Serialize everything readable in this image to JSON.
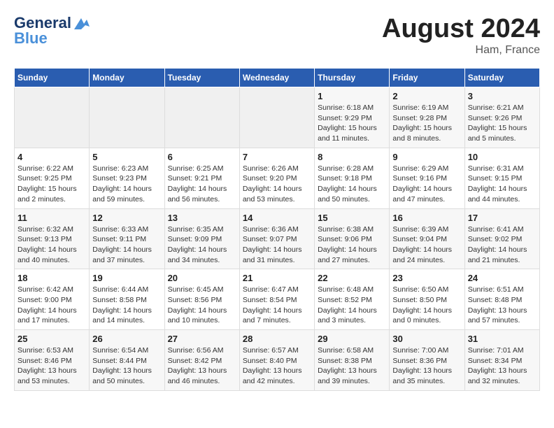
{
  "header": {
    "logo_line1": "General",
    "logo_line2": "Blue",
    "main_title": "August 2024",
    "subtitle": "Ham, France"
  },
  "calendar": {
    "days_of_week": [
      "Sunday",
      "Monday",
      "Tuesday",
      "Wednesday",
      "Thursday",
      "Friday",
      "Saturday"
    ],
    "weeks": [
      [
        {
          "day": "",
          "info": ""
        },
        {
          "day": "",
          "info": ""
        },
        {
          "day": "",
          "info": ""
        },
        {
          "day": "",
          "info": ""
        },
        {
          "day": "1",
          "info": "Sunrise: 6:18 AM\nSunset: 9:29 PM\nDaylight: 15 hours\nand 11 minutes."
        },
        {
          "day": "2",
          "info": "Sunrise: 6:19 AM\nSunset: 9:28 PM\nDaylight: 15 hours\nand 8 minutes."
        },
        {
          "day": "3",
          "info": "Sunrise: 6:21 AM\nSunset: 9:26 PM\nDaylight: 15 hours\nand 5 minutes."
        }
      ],
      [
        {
          "day": "4",
          "info": "Sunrise: 6:22 AM\nSunset: 9:25 PM\nDaylight: 15 hours\nand 2 minutes."
        },
        {
          "day": "5",
          "info": "Sunrise: 6:23 AM\nSunset: 9:23 PM\nDaylight: 14 hours\nand 59 minutes."
        },
        {
          "day": "6",
          "info": "Sunrise: 6:25 AM\nSunset: 9:21 PM\nDaylight: 14 hours\nand 56 minutes."
        },
        {
          "day": "7",
          "info": "Sunrise: 6:26 AM\nSunset: 9:20 PM\nDaylight: 14 hours\nand 53 minutes."
        },
        {
          "day": "8",
          "info": "Sunrise: 6:28 AM\nSunset: 9:18 PM\nDaylight: 14 hours\nand 50 minutes."
        },
        {
          "day": "9",
          "info": "Sunrise: 6:29 AM\nSunset: 9:16 PM\nDaylight: 14 hours\nand 47 minutes."
        },
        {
          "day": "10",
          "info": "Sunrise: 6:31 AM\nSunset: 9:15 PM\nDaylight: 14 hours\nand 44 minutes."
        }
      ],
      [
        {
          "day": "11",
          "info": "Sunrise: 6:32 AM\nSunset: 9:13 PM\nDaylight: 14 hours\nand 40 minutes."
        },
        {
          "day": "12",
          "info": "Sunrise: 6:33 AM\nSunset: 9:11 PM\nDaylight: 14 hours\nand 37 minutes."
        },
        {
          "day": "13",
          "info": "Sunrise: 6:35 AM\nSunset: 9:09 PM\nDaylight: 14 hours\nand 34 minutes."
        },
        {
          "day": "14",
          "info": "Sunrise: 6:36 AM\nSunset: 9:07 PM\nDaylight: 14 hours\nand 31 minutes."
        },
        {
          "day": "15",
          "info": "Sunrise: 6:38 AM\nSunset: 9:06 PM\nDaylight: 14 hours\nand 27 minutes."
        },
        {
          "day": "16",
          "info": "Sunrise: 6:39 AM\nSunset: 9:04 PM\nDaylight: 14 hours\nand 24 minutes."
        },
        {
          "day": "17",
          "info": "Sunrise: 6:41 AM\nSunset: 9:02 PM\nDaylight: 14 hours\nand 21 minutes."
        }
      ],
      [
        {
          "day": "18",
          "info": "Sunrise: 6:42 AM\nSunset: 9:00 PM\nDaylight: 14 hours\nand 17 minutes."
        },
        {
          "day": "19",
          "info": "Sunrise: 6:44 AM\nSunset: 8:58 PM\nDaylight: 14 hours\nand 14 minutes."
        },
        {
          "day": "20",
          "info": "Sunrise: 6:45 AM\nSunset: 8:56 PM\nDaylight: 14 hours\nand 10 minutes."
        },
        {
          "day": "21",
          "info": "Sunrise: 6:47 AM\nSunset: 8:54 PM\nDaylight: 14 hours\nand 7 minutes."
        },
        {
          "day": "22",
          "info": "Sunrise: 6:48 AM\nSunset: 8:52 PM\nDaylight: 14 hours\nand 3 minutes."
        },
        {
          "day": "23",
          "info": "Sunrise: 6:50 AM\nSunset: 8:50 PM\nDaylight: 14 hours\nand 0 minutes."
        },
        {
          "day": "24",
          "info": "Sunrise: 6:51 AM\nSunset: 8:48 PM\nDaylight: 13 hours\nand 57 minutes."
        }
      ],
      [
        {
          "day": "25",
          "info": "Sunrise: 6:53 AM\nSunset: 8:46 PM\nDaylight: 13 hours\nand 53 minutes."
        },
        {
          "day": "26",
          "info": "Sunrise: 6:54 AM\nSunset: 8:44 PM\nDaylight: 13 hours\nand 50 minutes."
        },
        {
          "day": "27",
          "info": "Sunrise: 6:56 AM\nSunset: 8:42 PM\nDaylight: 13 hours\nand 46 minutes."
        },
        {
          "day": "28",
          "info": "Sunrise: 6:57 AM\nSunset: 8:40 PM\nDaylight: 13 hours\nand 42 minutes."
        },
        {
          "day": "29",
          "info": "Sunrise: 6:58 AM\nSunset: 8:38 PM\nDaylight: 13 hours\nand 39 minutes."
        },
        {
          "day": "30",
          "info": "Sunrise: 7:00 AM\nSunset: 8:36 PM\nDaylight: 13 hours\nand 35 minutes."
        },
        {
          "day": "31",
          "info": "Sunrise: 7:01 AM\nSunset: 8:34 PM\nDaylight: 13 hours\nand 32 minutes."
        }
      ]
    ]
  }
}
